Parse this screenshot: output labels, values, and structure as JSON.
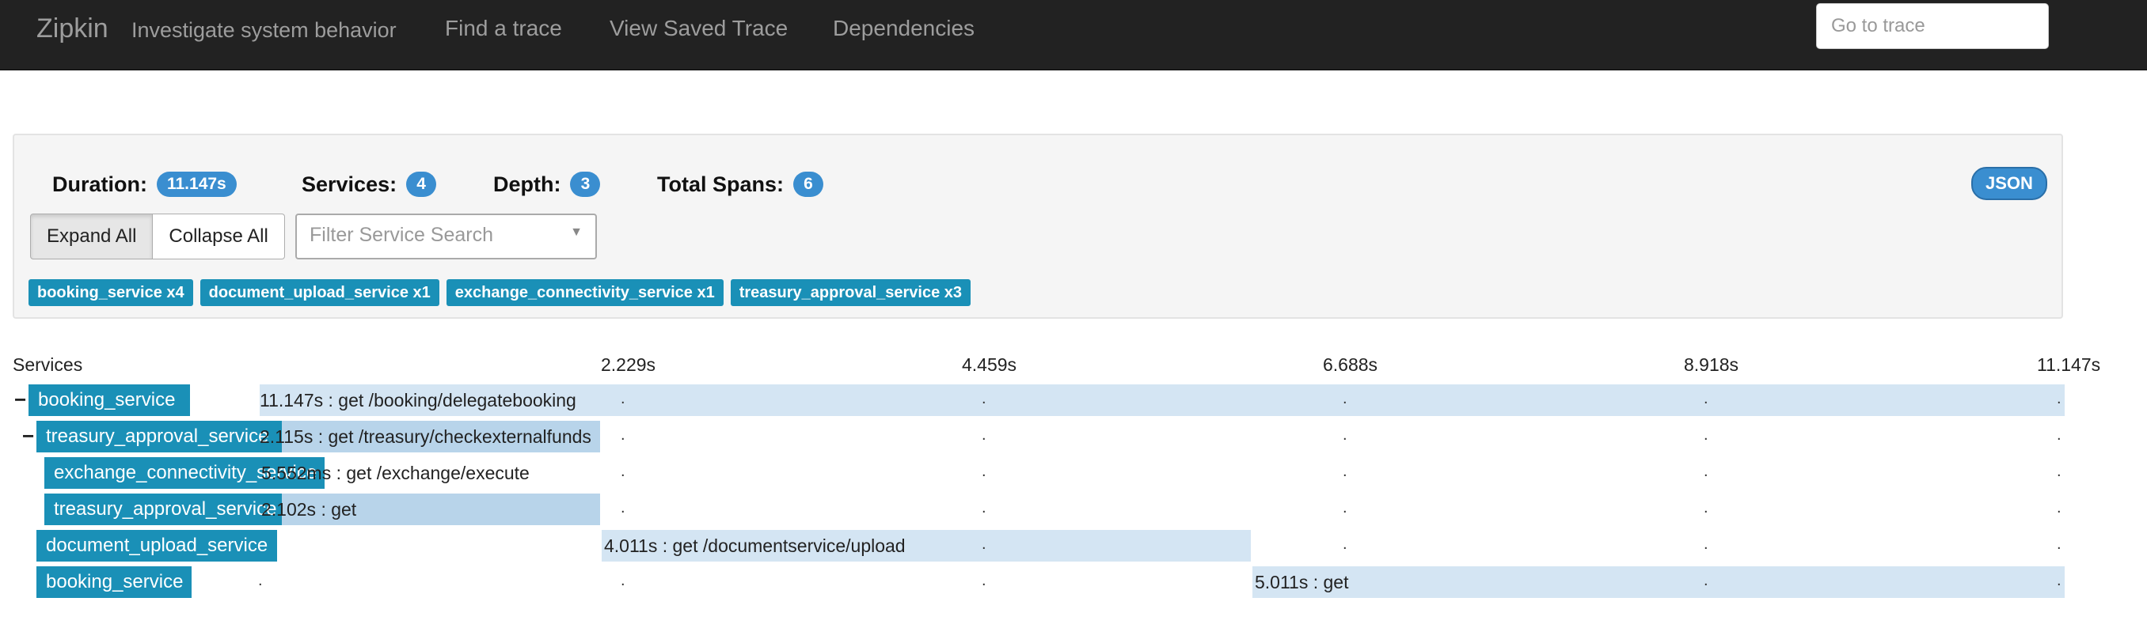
{
  "navbar": {
    "brand": "Zipkin",
    "subtitle": "Investigate system behavior",
    "links": [
      "Find a trace",
      "View Saved Trace",
      "Dependencies"
    ],
    "goto_placeholder": "Go to trace"
  },
  "summary": {
    "duration_label": "Duration:",
    "duration_value": "11.147s",
    "services_label": "Services:",
    "services_value": "4",
    "depth_label": "Depth:",
    "depth_value": "3",
    "total_spans_label": "Total Spans:",
    "total_spans_value": "6",
    "json_button": "JSON",
    "expand_all": "Expand All",
    "collapse_all": "Collapse All",
    "filter_placeholder": "Filter Service Search",
    "service_tags": [
      "booking_service x4",
      "document_upload_service x1",
      "exchange_connectivity_service x1",
      "treasury_approval_service x3"
    ]
  },
  "timeline": {
    "services_header": "Services",
    "ticks": [
      "2.229s",
      "4.459s",
      "6.688s",
      "8.918s",
      "11.147s"
    ],
    "spans": [
      {
        "toggle": "−",
        "service": "booking_service",
        "label": "11.147s : get /booking/delegatebooking"
      },
      {
        "toggle": "−",
        "service": "treasury_approval_service",
        "label": "2.115s : get /treasury/checkexternalfunds"
      },
      {
        "toggle": "",
        "service": "exchange_connectivity_service",
        "label": "5.552ms : get /exchange/execute"
      },
      {
        "toggle": "",
        "service": "treasury_approval_service",
        "label": "2.102s : get"
      },
      {
        "toggle": "",
        "service": "document_upload_service",
        "label": "4.011s : get /documentservice/upload"
      },
      {
        "toggle": "",
        "service": "booking_service",
        "label": "5.011s : get"
      }
    ]
  },
  "colors": {
    "navbar": "#222222",
    "badge": "#3a8ed0",
    "service_tag": "#1a90b7",
    "span_bar": "#d4e5f3"
  }
}
